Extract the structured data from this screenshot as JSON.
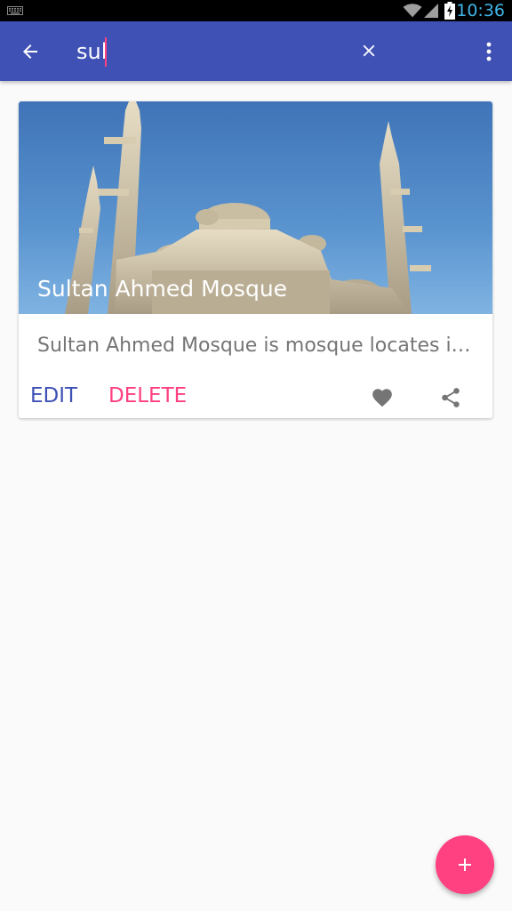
{
  "status_bar": {
    "time": "10:36",
    "icons": [
      "keyboard-icon",
      "wifi-icon",
      "signal-icon",
      "battery-charging-icon"
    ],
    "time_color": "#3fb6e8"
  },
  "app_bar": {
    "search_value": "sul",
    "icons": [
      "back-arrow-icon",
      "close-icon",
      "more-vert-icon"
    ],
    "color": "#3f51b5",
    "caret_color": "#ff4081"
  },
  "card": {
    "title": "Sultan Ahmed Mosque",
    "description": "Sultan Ahmed Mosque is mosque locates i…",
    "edit_label": "EDIT",
    "delete_label": "DELETE",
    "icons": [
      "favorite-icon",
      "share-icon"
    ],
    "edit_color": "#3f51b5",
    "delete_color": "#ff4081"
  },
  "fab": {
    "icon": "add-icon",
    "color": "#ff4081"
  }
}
